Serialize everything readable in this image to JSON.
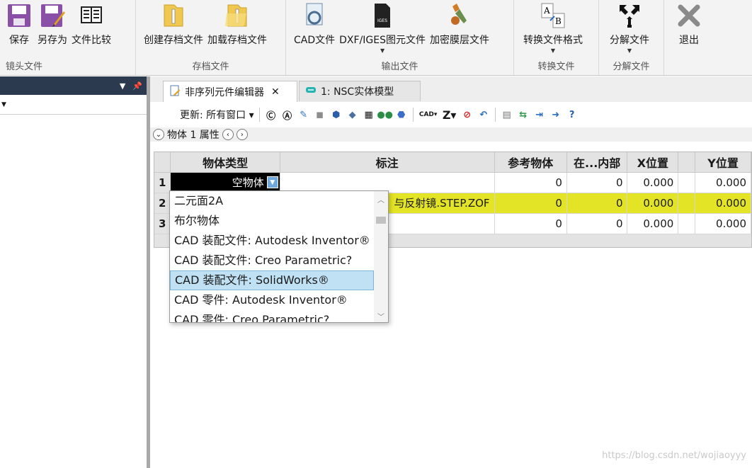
{
  "ribbon": {
    "groups": [
      {
        "label": "镜头文件",
        "buttons": [
          "保存",
          "另存为",
          "文件比较"
        ]
      },
      {
        "label": "存档文件",
        "buttons": [
          "创建存档文件",
          "加载存档文件"
        ]
      },
      {
        "label": "输出文件",
        "buttons": [
          "CAD文件",
          "DXF/IGES图元文件",
          "加密膜层文件"
        ]
      },
      {
        "label": "转换文件",
        "buttons": [
          "转换文件格式"
        ]
      },
      {
        "label": "分解文件",
        "buttons": [
          "分解文件"
        ]
      },
      {
        "label": "",
        "buttons": [
          "退出"
        ]
      }
    ]
  },
  "tabs": [
    {
      "label": "非序列元件编辑器",
      "close": "✕"
    },
    {
      "label": "1: NSC实体模型"
    }
  ],
  "toolbar": {
    "update_label": "更新: 所有窗口",
    "cad_label": "CAD"
  },
  "propbar": {
    "label": "物体 1 属性"
  },
  "grid": {
    "headers": [
      "物体类型",
      "标注",
      "参考物体",
      "在...内部",
      "X位置",
      "Y位置"
    ],
    "rows": [
      {
        "num": "1",
        "type": "空物体",
        "comment": "",
        "ref": "0",
        "inside": "0",
        "x": "0.000",
        "y": "0.000"
      },
      {
        "num": "2",
        "type": "",
        "comment": "与反射镜.STEP.ZOF",
        "ref": "0",
        "inside": "0",
        "x": "0.000",
        "y": "0.000"
      },
      {
        "num": "3",
        "type": "",
        "comment": "",
        "ref": "0",
        "inside": "0",
        "x": "0.000",
        "y": "0.000"
      }
    ]
  },
  "dropdown": {
    "items": [
      "二元面2A",
      "布尔物体",
      "CAD 装配文件: Autodesk Inventor®",
      "CAD 装配文件: Creo Parametric?",
      "CAD 装配文件: SolidWorks®",
      "CAD 零件: Autodesk Inventor®",
      "CAD 零件: Creo Parametric?"
    ],
    "selected_index": 4
  },
  "watermark": "https://blog.csdn.net/wojiaoyyy"
}
